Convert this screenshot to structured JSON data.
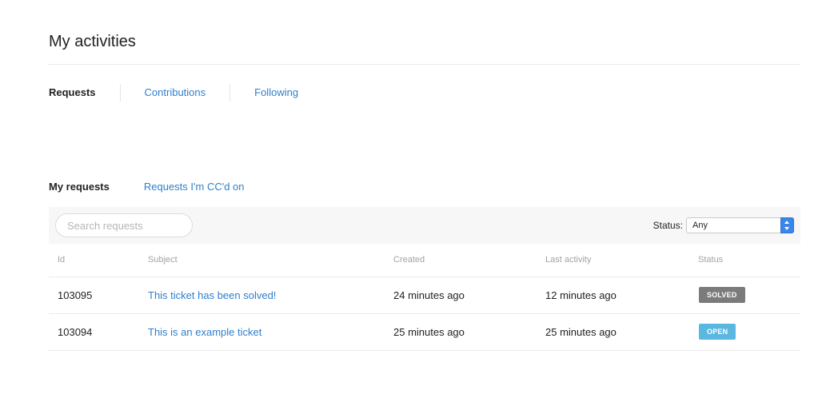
{
  "page": {
    "title": "My activities"
  },
  "top_tabs": [
    {
      "label": "Requests",
      "active": true
    },
    {
      "label": "Contributions",
      "active": false
    },
    {
      "label": "Following",
      "active": false
    }
  ],
  "sub_tabs": [
    {
      "label": "My requests",
      "active": true
    },
    {
      "label": "Requests I'm CC'd on",
      "active": false
    }
  ],
  "toolbar": {
    "search_placeholder": "Search requests",
    "search_value": "",
    "status_label": "Status:",
    "status_selected": "Any"
  },
  "table": {
    "columns": [
      "Id",
      "Subject",
      "Created",
      "Last activity",
      "Status"
    ],
    "rows": [
      {
        "id": "103095",
        "subject": "This ticket has been solved!",
        "created": "24 minutes ago",
        "last_activity": "12 minutes ago",
        "status": "SOLVED",
        "status_color": "#7b7b7b"
      },
      {
        "id": "103094",
        "subject": "This is an example ticket",
        "created": "25 minutes ago",
        "last_activity": "25 minutes ago",
        "status": "OPEN",
        "status_color": "#5ab8e0"
      }
    ]
  },
  "colors": {
    "link": "#2f7fcc",
    "select_accent": "#3b86e8"
  }
}
